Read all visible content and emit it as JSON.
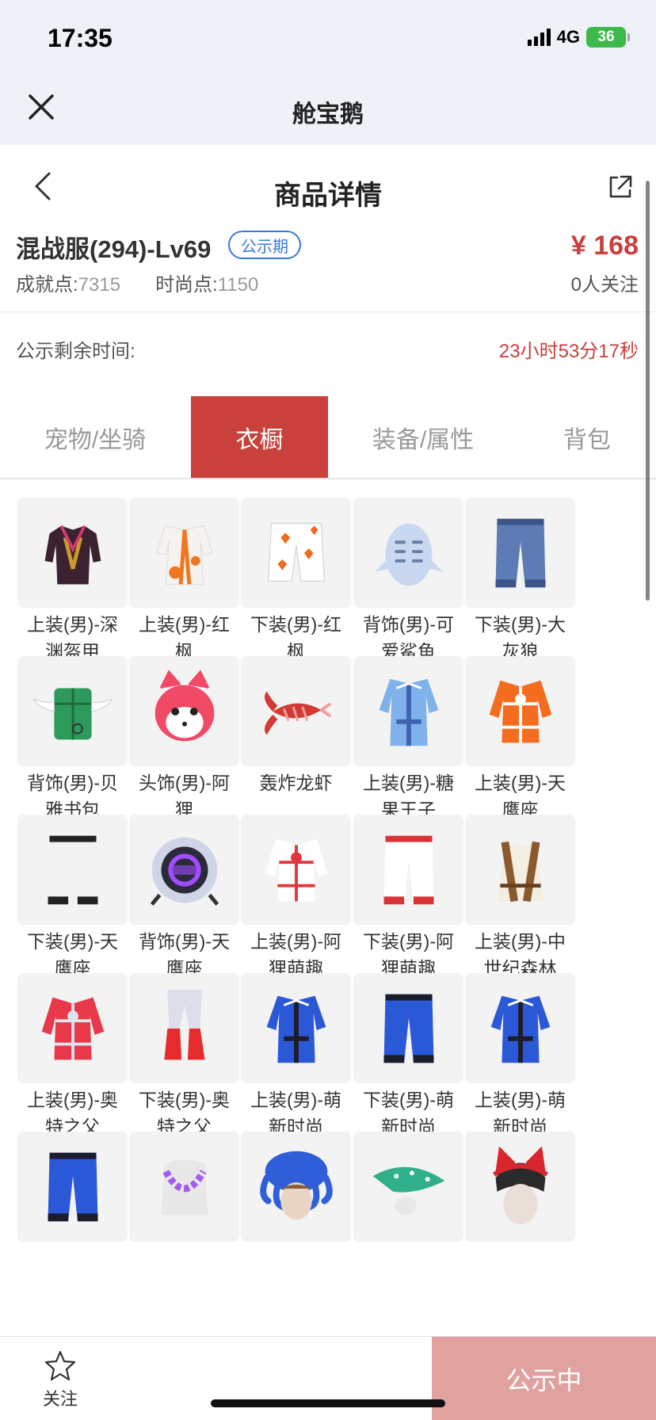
{
  "status_bar": {
    "time": "17:35",
    "network": "4G",
    "battery": "36"
  },
  "miniapp": {
    "title": "舱宝鹅"
  },
  "header": {
    "title": "商品详情"
  },
  "product": {
    "name": "混战服(294)-Lv69",
    "badge": "公示期",
    "achievement_label": "成就点:",
    "achievement_value": "7315",
    "fashion_label": "时尚点:",
    "fashion_value": "1150",
    "price": "¥ 168",
    "followers": "0人关注"
  },
  "countdown": {
    "label": "公示剩余时间:",
    "value": "23小时53分17秒"
  },
  "tabs": [
    {
      "label": "宠物/坐骑",
      "active": false
    },
    {
      "label": "衣橱",
      "active": true
    },
    {
      "label": "装备/属性",
      "active": false
    },
    {
      "label": "背包",
      "active": false
    }
  ],
  "items": [
    {
      "name": "上装(男)-深\n渊盔甲",
      "icon": "dark-armor",
      "colors": [
        "#3b2230",
        "#c99a2e"
      ]
    },
    {
      "name": "上装(男)-红\n枫",
      "icon": "robe",
      "colors": [
        "#f6f2ee",
        "#f0761f"
      ]
    },
    {
      "name": "下装(男)-红\n枫",
      "icon": "shorts",
      "colors": [
        "#ffffff",
        "#ef6a1e"
      ]
    },
    {
      "name": "背饰(男)-可\n爱鲨鱼",
      "icon": "shark",
      "colors": [
        "#c9d8f0",
        "#6a7fa6"
      ]
    },
    {
      "name": "下装(男)-大\n灰狼",
      "icon": "pants",
      "colors": [
        "#5d7bb5",
        "#3c5488"
      ]
    },
    {
      "name": "背饰(男)-贝\n雅书包",
      "icon": "bag",
      "colors": [
        "#2d9a5c",
        "#ffffff"
      ]
    },
    {
      "name": "头饰(男)-阿\n狸",
      "icon": "fox-head",
      "colors": [
        "#f04a66",
        "#ffffff"
      ]
    },
    {
      "name": "轰炸龙虾",
      "icon": "lobster",
      "colors": [
        "#d23a34",
        "#f1a19d"
      ]
    },
    {
      "name": "上装(男)-糖\n果王子",
      "icon": "coat",
      "colors": [
        "#7fb2ea",
        "#3f64b3"
      ]
    },
    {
      "name": "上装(男)-天\n鹰座",
      "icon": "jacket",
      "colors": [
        "#f46d1e",
        "#ffffff"
      ]
    },
    {
      "name": "下装(男)-天\n鹰座",
      "icon": "pants",
      "colors": [
        "#f2f2f2",
        "#222222"
      ]
    },
    {
      "name": "背饰(男)-天\n鹰座",
      "icon": "pod",
      "colors": [
        "#2a2a3a",
        "#a04cff"
      ]
    },
    {
      "name": "上装(男)-阿\n狸萌趣",
      "icon": "jacket",
      "colors": [
        "#ffffff",
        "#e0383a"
      ]
    },
    {
      "name": "下装(男)-阿\n狸萌趣",
      "icon": "pants",
      "colors": [
        "#ffffff",
        "#d9333a"
      ]
    },
    {
      "name": "上装(男)-中\n世纪森林",
      "icon": "vest",
      "colors": [
        "#f3ede2",
        "#8a5a2e"
      ]
    },
    {
      "name": "上装(男)-奥\n特之父",
      "icon": "jacket",
      "colors": [
        "#e8384a",
        "#dfe3ec"
      ]
    },
    {
      "name": "下装(男)-奥\n特之父",
      "icon": "boots",
      "colors": [
        "#dcdfea",
        "#e52b2b"
      ]
    },
    {
      "name": "上装(男)-萌\n新时尚",
      "icon": "coat",
      "colors": [
        "#2a58d6",
        "#1c1c2a"
      ]
    },
    {
      "name": "下装(男)-萌\n新时尚",
      "icon": "pants",
      "colors": [
        "#2a58d6",
        "#1c1c2a"
      ]
    },
    {
      "name": "上装(男)-萌\n新时尚",
      "icon": "coat",
      "colors": [
        "#2a58d6",
        "#1c1c2a"
      ]
    },
    {
      "name": "",
      "icon": "pants",
      "colors": [
        "#2a58d6",
        "#1c1c2a"
      ]
    },
    {
      "name": "",
      "icon": "lei",
      "colors": [
        "#e8e8e8",
        "#a45cf0"
      ]
    },
    {
      "name": "",
      "icon": "octopus-hat",
      "colors": [
        "#2f5ed8",
        "#8a5a3c"
      ]
    },
    {
      "name": "",
      "icon": "leaf-hat",
      "colors": [
        "#2fb08a",
        "#e8e8e8"
      ]
    },
    {
      "name": "",
      "icon": "cat-ears",
      "colors": [
        "#d9262d",
        "#2a2a2a"
      ]
    }
  ],
  "bottom_bar": {
    "follow_label": "关注",
    "status_label": "公示中"
  }
}
